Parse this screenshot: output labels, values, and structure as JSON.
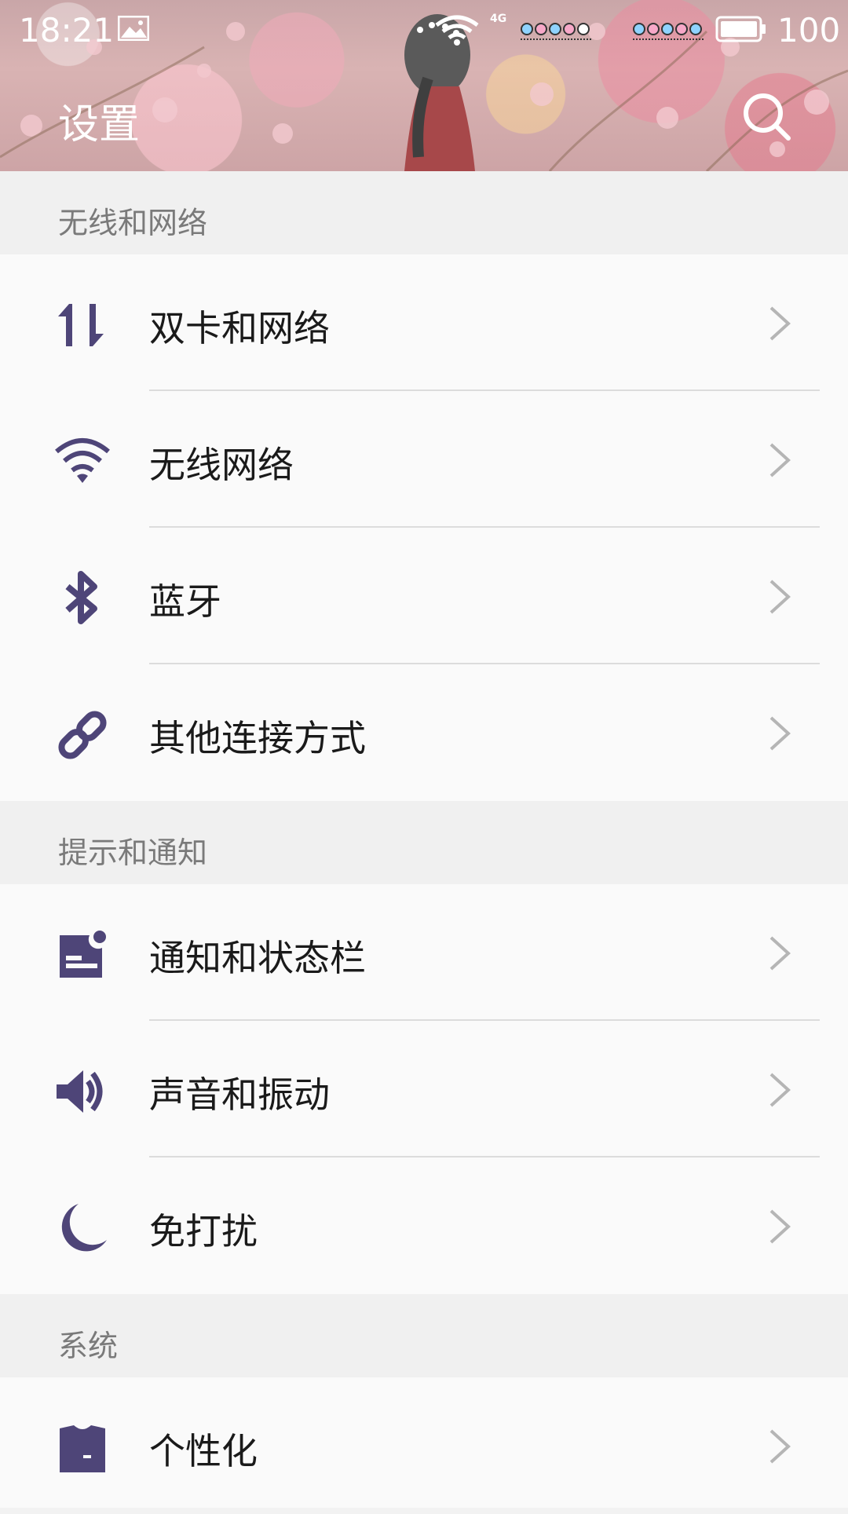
{
  "status_bar": {
    "time": "18:21",
    "network_type": "4G",
    "battery": "100"
  },
  "header": {
    "title": "设置"
  },
  "sections": [
    {
      "title": "无线和网络",
      "items": [
        {
          "label": "双卡和网络",
          "icon": "dual-sim-arrows-icon"
        },
        {
          "label": "无线网络",
          "icon": "wifi-icon"
        },
        {
          "label": "蓝牙",
          "icon": "bluetooth-icon"
        },
        {
          "label": "其他连接方式",
          "icon": "link-icon"
        }
      ]
    },
    {
      "title": "提示和通知",
      "items": [
        {
          "label": "通知和状态栏",
          "icon": "notification-icon"
        },
        {
          "label": "声音和振动",
          "icon": "speaker-icon"
        },
        {
          "label": "免打扰",
          "icon": "moon-icon"
        }
      ]
    },
    {
      "title": "系统",
      "items": [
        {
          "label": "个性化",
          "icon": "shirt-icon"
        }
      ]
    }
  ],
  "colors": {
    "icon_accent": "#4e4578",
    "section_bg": "#f0f0f0",
    "row_bg": "#fafafa",
    "chevron": "#b5b5b5"
  }
}
